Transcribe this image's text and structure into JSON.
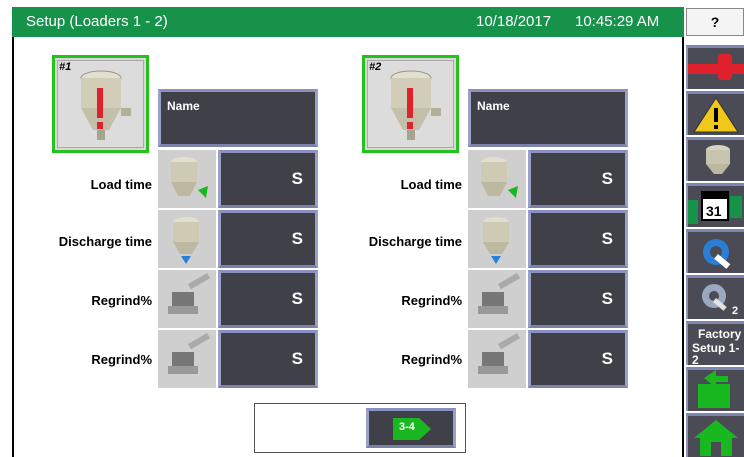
{
  "header": {
    "title": "Setup (Loaders 1 - 2)",
    "date": "10/18/2017",
    "time": "10:45:29 AM"
  },
  "toolbar": {
    "help_label": "?",
    "factory_label": "Factory",
    "factory_sub": "Setup 1-2"
  },
  "loaders": [
    {
      "number": "#1",
      "name_label": "Name",
      "rows": [
        {
          "label": "Load time",
          "unit": "S"
        },
        {
          "label": "Discharge time",
          "unit": "S"
        },
        {
          "label": "Regrind%",
          "unit": "S"
        },
        {
          "label": "Regrind%",
          "unit": "S"
        }
      ]
    },
    {
      "number": "#2",
      "name_label": "Name",
      "rows": [
        {
          "label": "Load time",
          "unit": "S"
        },
        {
          "label": "Discharge time",
          "unit": "S"
        },
        {
          "label": "Regrind%",
          "unit": "S"
        },
        {
          "label": "Regrind%",
          "unit": "S"
        }
      ]
    }
  ],
  "nav": {
    "next_label": "3-4"
  },
  "colors": {
    "accent_green": "#17924a",
    "panel_dark": "#404048",
    "alert_red": "#e0202a",
    "warning_yellow": "#f0c81a"
  }
}
